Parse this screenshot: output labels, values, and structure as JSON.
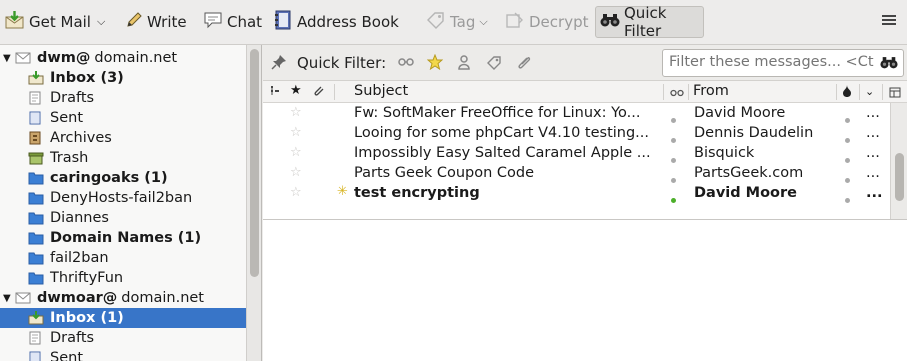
{
  "toolbar": {
    "get_mail": "Get Mail",
    "write": "Write",
    "chat": "Chat",
    "address_book": "Address Book",
    "tag": "Tag",
    "decrypt": "Decrypt",
    "quick_filter": "Quick Filter"
  },
  "folders": [
    {
      "account": "dwm@",
      "domain": "domain.net"
    },
    {
      "label": "Inbox (3)",
      "icon": "inbox-icon",
      "bold": true
    },
    {
      "label": "Drafts",
      "icon": "drafts-icon"
    },
    {
      "label": "Sent",
      "icon": "sent-icon"
    },
    {
      "label": "Archives",
      "icon": "archives-icon"
    },
    {
      "label": "Trash",
      "icon": "trash-icon"
    },
    {
      "label": "caringoaks (1)",
      "icon": "folder-icon",
      "bold": true
    },
    {
      "label": "DenyHosts-fail2ban",
      "icon": "folder-icon"
    },
    {
      "label": "Diannes",
      "icon": "folder-icon"
    },
    {
      "label": "Domain Names (1)",
      "icon": "folder-icon",
      "bold": true
    },
    {
      "label": "fail2ban",
      "icon": "folder-icon"
    },
    {
      "label": "ThriftyFun",
      "icon": "folder-icon"
    },
    {
      "account": "dwmoar@",
      "domain": "domain.net"
    },
    {
      "label": "Inbox (1)",
      "icon": "inbox-icon",
      "bold": true,
      "selected": true
    },
    {
      "label": "Drafts",
      "icon": "drafts-icon"
    },
    {
      "label": "Sent",
      "icon": "sent-icon"
    }
  ],
  "quick_filter": {
    "label": "Quick Filter:",
    "placeholder": "Filter these messages... <Ct"
  },
  "columns": {
    "subject": "Subject",
    "from": "From"
  },
  "messages": [
    {
      "subject": "Fw: SoftMaker FreeOffice for Linux: Yo...",
      "from": "David Moore",
      "unread": false
    },
    {
      "subject": "Looing for some phpCart V4.10 testing...",
      "from": "Dennis Daudelin",
      "unread": false
    },
    {
      "subject": "Impossibly Easy Salted Caramel Apple ...",
      "from": "Bisquick",
      "unread": false
    },
    {
      "subject": "Parts Geek Coupon Code",
      "from": "PartsGeek.com",
      "unread": false
    },
    {
      "subject": "test encrypting",
      "from": "David Moore",
      "unread": true
    }
  ],
  "colors": {
    "selection": "#3875c8",
    "folder_blue": "#3b7fd4",
    "online_dot": "#4caf2a"
  }
}
